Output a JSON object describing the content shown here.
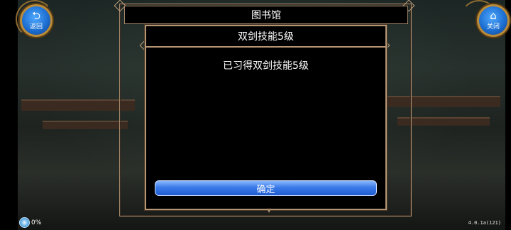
{
  "header": {
    "title": "图书馆"
  },
  "dialog": {
    "title": "双剑技能5级",
    "message": "已习得双剑技能5级",
    "confirm_label": "确定"
  },
  "nav": {
    "back_label": "返回",
    "close_label": "关闭"
  },
  "status": {
    "loading_percent": "0%",
    "version": "4.0.1a(121)"
  },
  "colors": {
    "accent_button": "#3a7ae8",
    "frame_gold": "#b59574"
  }
}
